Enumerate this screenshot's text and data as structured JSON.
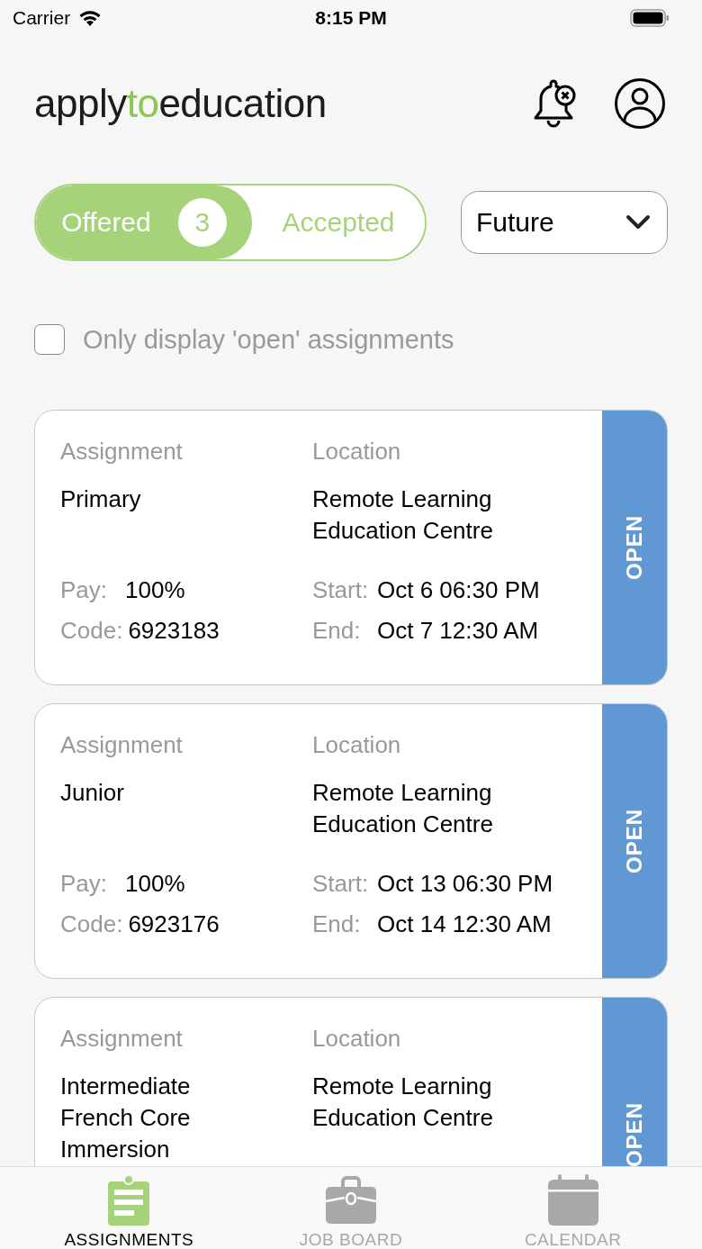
{
  "status_bar": {
    "carrier": "Carrier",
    "time": "8:15 PM"
  },
  "header": {
    "logo": [
      "apply",
      "to",
      "education"
    ]
  },
  "segments": [
    {
      "label": "Offered",
      "badge": "3",
      "selected": true
    },
    {
      "label": "Accepted",
      "selected": false
    }
  ],
  "period_dropdown": {
    "value": "Future"
  },
  "open_filter": {
    "label": "Only display 'open' assignments",
    "checked": false
  },
  "assignments": [
    {
      "assignment_label": "Assignment",
      "assignment": "Primary",
      "location_label": "Location",
      "location": "Remote Learning Education Centre",
      "details": [
        [
          "Pay:",
          "100%",
          "Start:",
          "Oct 6 06:30 PM"
        ],
        [
          "Code:",
          "6923183",
          "End:",
          "Oct 7 12:30 AM"
        ]
      ],
      "status": "OPEN"
    },
    {
      "assignment_label": "Assignment",
      "assignment": "Junior",
      "location_label": "Location",
      "location": "Remote Learning Education Centre",
      "details": [
        [
          "Pay:",
          "100%",
          "Start:",
          "Oct 13 06:30 PM"
        ],
        [
          "Code:",
          "6923176",
          "End:",
          "Oct 14 12:30 AM"
        ]
      ],
      "status": "OPEN"
    },
    {
      "assignment_label": "Assignment",
      "assignment": "Intermediate French Core Immersion",
      "location_label": "Location",
      "location": "Remote Learning Education Centre",
      "status": "OPEN"
    }
  ],
  "tab_bar": [
    {
      "label": "ASSIGNMENTS",
      "kind": "clipboard",
      "selected": true
    },
    {
      "label": "JOB BOARD",
      "kind": "briefcase",
      "selected": false
    },
    {
      "label": "CALENDAR",
      "kind": "calendar",
      "selected": false
    }
  ]
}
